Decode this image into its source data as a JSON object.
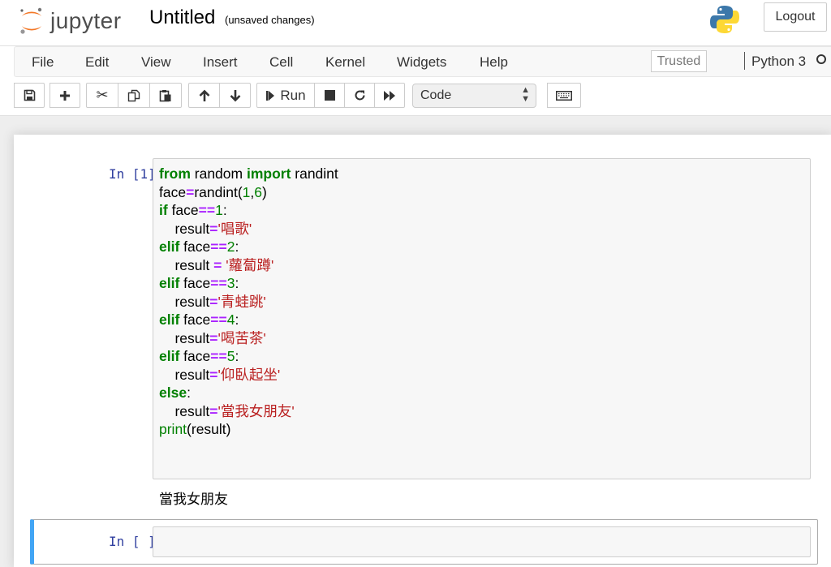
{
  "header": {
    "logo_text": "jupyter",
    "notebook_title": "Untitled",
    "save_status": "(unsaved changes)",
    "logout_label": "Logout"
  },
  "menubar": {
    "items": [
      "File",
      "Edit",
      "View",
      "Insert",
      "Cell",
      "Kernel",
      "Widgets",
      "Help"
    ],
    "trusted_label": "Trusted",
    "kernel_name": "Python 3"
  },
  "toolbar": {
    "run_label": "Run",
    "cell_type": "Code",
    "icons": [
      "save-icon",
      "plus-icon",
      "cut-icon",
      "copy-icon",
      "paste-icon",
      "arrow-up-icon",
      "arrow-down-icon",
      "step-forward-icon",
      "stop-icon",
      "restart-icon",
      "fast-forward-icon",
      "keyboard-icon"
    ]
  },
  "cells": [
    {
      "prompt": "In [1]:",
      "code_lines": [
        "from random import randint",
        "face=randint(1,6)",
        "if face==1:",
        "    result='唱歌'",
        "elif face==2:",
        "    result = '蘿蔔蹲'",
        "elif face==3:",
        "    result='青蛙跳'",
        "elif face==4:",
        "    result='喝苦茶'",
        "elif face==5:",
        "    result='仰臥起坐'",
        "else:",
        "    result='當我女朋友'",
        "print(result)"
      ],
      "output": "當我女朋友"
    },
    {
      "prompt": "In [ ]:",
      "code_lines": []
    }
  ],
  "colors": {
    "prompt": "#303f9f",
    "keyword": "#008000",
    "operator": "#aa22ff",
    "string": "#ba2121",
    "selected_cell_border": "#42a5f5"
  }
}
